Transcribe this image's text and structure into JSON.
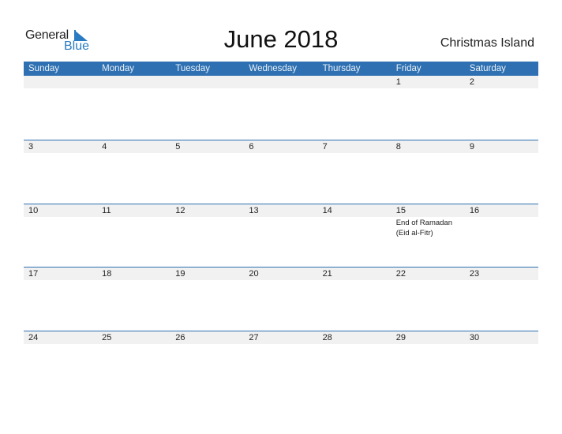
{
  "logo": {
    "line1": "General",
    "line2": "Blue"
  },
  "title": "June 2018",
  "country": "Christmas Island",
  "weekdays": [
    "Sunday",
    "Monday",
    "Tuesday",
    "Wednesday",
    "Thursday",
    "Friday",
    "Saturday"
  ],
  "weeks": [
    {
      "days": [
        "",
        "",
        "",
        "",
        "",
        "1",
        "2"
      ],
      "events": [
        "",
        "",
        "",
        "",
        "",
        "",
        ""
      ]
    },
    {
      "days": [
        "3",
        "4",
        "5",
        "6",
        "7",
        "8",
        "9"
      ],
      "events": [
        "",
        "",
        "",
        "",
        "",
        "",
        ""
      ]
    },
    {
      "days": [
        "10",
        "11",
        "12",
        "13",
        "14",
        "15",
        "16"
      ],
      "events": [
        "",
        "",
        "",
        "",
        "",
        "End of Ramadan (Eid al-Fitr)",
        ""
      ]
    },
    {
      "days": [
        "17",
        "18",
        "19",
        "20",
        "21",
        "22",
        "23"
      ],
      "events": [
        "",
        "",
        "",
        "",
        "",
        "",
        ""
      ]
    },
    {
      "days": [
        "24",
        "25",
        "26",
        "27",
        "28",
        "29",
        "30"
      ],
      "events": [
        "",
        "",
        "",
        "",
        "",
        "",
        ""
      ]
    }
  ],
  "colors": {
    "accent": "#2e70b1",
    "day_row_bg": "#f1f1f1"
  }
}
